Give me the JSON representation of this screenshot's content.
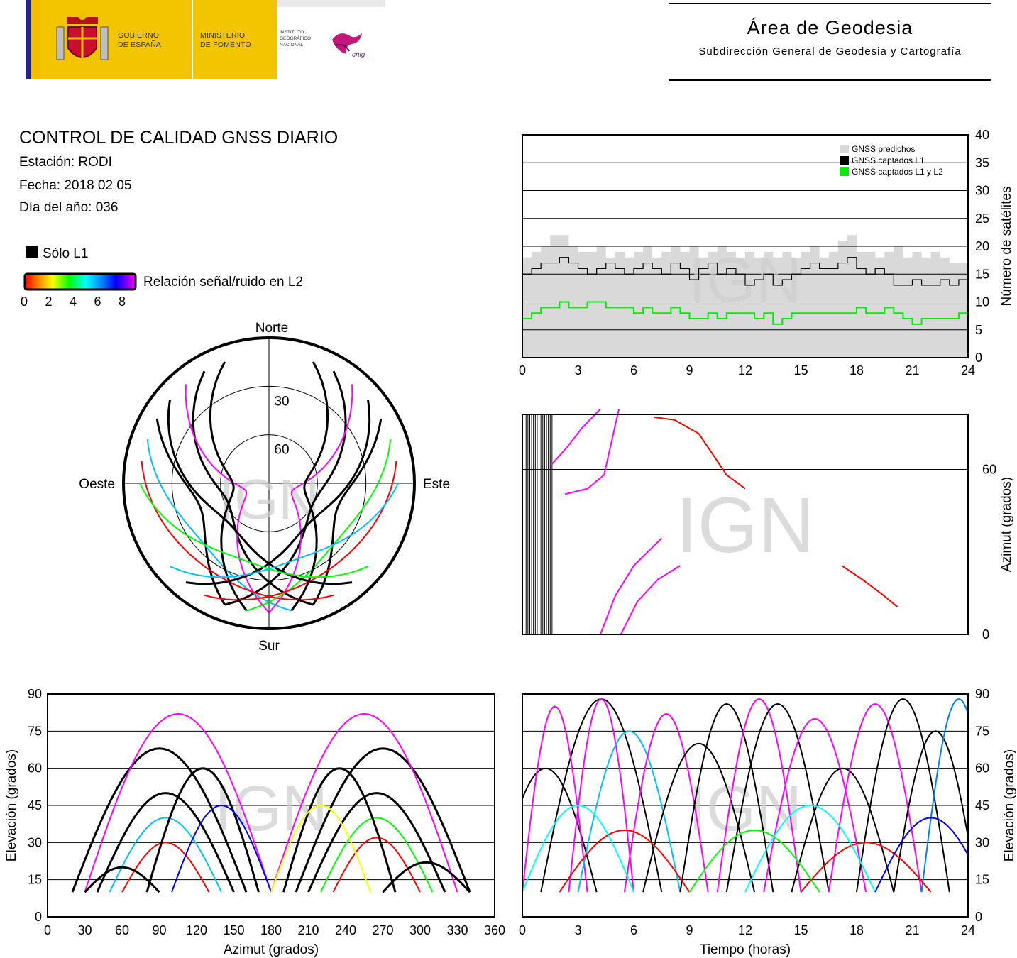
{
  "header": {
    "gov_line1": "GOBIERNO",
    "gov_line2": "DE ESPAÑA",
    "min_line1": "MINISTERIO",
    "min_line2": "DE FOMENTO",
    "inst_line1": "INSTITUTO",
    "inst_line2": "GEOGRÁFICO",
    "inst_line3": "NACIONAL",
    "cnig": "cnig",
    "area_title": "Área de Geodesia",
    "area_subtitle": "Subdirección General de Geodesia y Cartografía"
  },
  "info": {
    "title": "CONTROL DE CALIDAD GNSS DIARIO",
    "station": "Estación: RODI",
    "date": "Fecha: 2018 02 05",
    "doy": "Día del año: 036"
  },
  "legend": {
    "l1_only": "Sólo L1",
    "snr_label": "Relación señal/ruido en L2",
    "snr_ticks": [
      "0",
      "2",
      "4",
      "6",
      "8"
    ]
  },
  "watermark": "IGN",
  "colors": {
    "predicted": "#d9d9d9",
    "l1": "#000000",
    "l1l2": "#00ee00",
    "snr_scale": [
      "#ff0000",
      "#ff8000",
      "#ffff00",
      "#00ff00",
      "#00ffff",
      "#0080ff",
      "#0000ff",
      "#8000ff",
      "#ff00ff"
    ]
  },
  "chart_data": [
    {
      "id": "satellites",
      "type": "area",
      "xlabel": "",
      "ylabel": "Número de satélites",
      "xlim": [
        0,
        24
      ],
      "ylim": [
        0,
        40
      ],
      "xticks": [
        "0",
        "3",
        "6",
        "9",
        "12",
        "15",
        "18",
        "21",
        "24"
      ],
      "yticks": [
        "0",
        "5",
        "10",
        "15",
        "20",
        "25",
        "30",
        "35",
        "40"
      ],
      "grid": true,
      "legend_position": "top-right",
      "series": [
        {
          "name": "GNSS predichos",
          "x": [
            0,
            0.5,
            1,
            1.5,
            2,
            2.5,
            3,
            3.5,
            4,
            4.5,
            5,
            5.5,
            6,
            6.5,
            7,
            7.5,
            8,
            8.5,
            9,
            9.5,
            10,
            10.5,
            11,
            11.5,
            12,
            12.5,
            13,
            13.5,
            14,
            14.5,
            15,
            15.5,
            16,
            16.5,
            17,
            17.5,
            18,
            18.5,
            19,
            19.5,
            20,
            20.5,
            21,
            21.5,
            22,
            22.5,
            23,
            23.5,
            24
          ],
          "values": [
            18,
            19,
            20,
            22,
            22,
            20,
            19,
            19,
            20,
            18,
            19,
            18,
            19,
            20,
            18,
            19,
            20,
            19,
            20,
            18,
            19,
            20,
            19,
            18,
            19,
            18,
            19,
            18,
            19,
            18,
            19,
            20,
            18,
            19,
            21,
            22,
            19,
            19,
            18,
            19,
            20,
            18,
            19,
            18,
            19,
            18,
            17,
            17,
            17
          ]
        },
        {
          "name": "GNSS captados L1",
          "x": [
            0,
            0.5,
            1,
            1.5,
            2,
            2.5,
            3,
            3.5,
            4,
            4.5,
            5,
            5.5,
            6,
            6.5,
            7,
            7.5,
            8,
            8.5,
            9,
            9.5,
            10,
            10.5,
            11,
            11.5,
            12,
            12.5,
            13,
            13.5,
            14,
            14.5,
            15,
            15.5,
            16,
            16.5,
            17,
            17.5,
            18,
            18.5,
            19,
            19.5,
            20,
            20.5,
            21,
            21.5,
            22,
            22.5,
            23,
            23.5,
            24
          ],
          "values": [
            15,
            16,
            17,
            17,
            18,
            17,
            16,
            15,
            16,
            17,
            16,
            15,
            16,
            17,
            16,
            15,
            17,
            16,
            14,
            16,
            17,
            15,
            16,
            15,
            13,
            14,
            15,
            13,
            14,
            15,
            16,
            17,
            16,
            16,
            17,
            18,
            16,
            15,
            16,
            15,
            13,
            13,
            14,
            13,
            13,
            14,
            13,
            14,
            14
          ]
        },
        {
          "name": "GNSS captados L1 y L2",
          "x": [
            0,
            0.5,
            1,
            1.5,
            2,
            2.5,
            3,
            3.5,
            4,
            4.5,
            5,
            5.5,
            6,
            6.5,
            7,
            7.5,
            8,
            8.5,
            9,
            9.5,
            10,
            10.5,
            11,
            11.5,
            12,
            12.5,
            13,
            13.5,
            14,
            14.5,
            15,
            15.5,
            16,
            16.5,
            17,
            17.5,
            18,
            18.5,
            19,
            19.5,
            20,
            20.5,
            21,
            21.5,
            22,
            22.5,
            23,
            23.5,
            24
          ],
          "values": [
            7,
            8,
            9,
            9,
            10,
            9,
            9,
            10,
            10,
            9,
            9,
            9,
            8,
            9,
            8,
            8,
            9,
            8,
            7,
            7,
            8,
            7,
            8,
            8,
            8,
            7,
            8,
            6,
            7,
            8,
            8,
            8,
            8,
            8,
            8,
            8,
            9,
            8,
            8,
            9,
            8,
            7,
            6,
            7,
            7,
            7,
            7,
            8,
            8
          ]
        }
      ]
    },
    {
      "id": "skyplot",
      "type": "scatter",
      "title": "",
      "directions": {
        "north": "Norte",
        "south": "Sur",
        "west": "Oeste",
        "east": "Este"
      },
      "ring_labels": [
        "30",
        "60"
      ],
      "description_series": "polar tracks (azimuth, elevation) colored by SNR",
      "tracks": [
        {
          "az0": 330,
          "az1": 160,
          "emax": 62,
          "color": "#000000"
        },
        {
          "az0": 30,
          "az1": 200,
          "emax": 60,
          "color": "#000000"
        },
        {
          "az0": 320,
          "az1": 180,
          "emax": 75,
          "color": "#ff00ff"
        },
        {
          "az0": 40,
          "az1": 180,
          "emax": 75,
          "color": "#ff00ff"
        },
        {
          "az0": 300,
          "az1": 200,
          "emax": 45,
          "color": "#000000"
        },
        {
          "az0": 60,
          "az1": 160,
          "emax": 45,
          "color": "#000000"
        },
        {
          "az0": 290,
          "az1": 170,
          "emax": 35,
          "color": "#00c0ff"
        },
        {
          "az0": 70,
          "az1": 190,
          "emax": 35,
          "color": "#00ff00"
        },
        {
          "az0": 310,
          "az1": 140,
          "emax": 55,
          "color": "#000000"
        },
        {
          "az0": 50,
          "az1": 220,
          "emax": 55,
          "color": "#000000"
        },
        {
          "az0": 280,
          "az1": 150,
          "emax": 25,
          "color": "#ff0000"
        },
        {
          "az0": 80,
          "az1": 210,
          "emax": 25,
          "color": "#ff0000"
        },
        {
          "az0": 340,
          "az1": 190,
          "emax": 68,
          "color": "#000000"
        },
        {
          "az0": 20,
          "az1": 170,
          "emax": 68,
          "color": "#000000"
        },
        {
          "az0": 270,
          "az1": 130,
          "emax": 40,
          "color": "#00ff00"
        },
        {
          "az0": 90,
          "az1": 230,
          "emax": 40,
          "color": "#00c0ff"
        }
      ]
    },
    {
      "id": "azimuth_time",
      "type": "line",
      "xlabel": "",
      "ylabel": "Azimut (grados)",
      "ylim": [
        0,
        80
      ],
      "yticks": [
        "0",
        "60"
      ],
      "grid": true,
      "series": [
        {
          "color": "#ff00ff",
          "x": [
            1.6,
            2.4,
            3.2,
            4.2
          ],
          "values": [
            62,
            68,
            75,
            82
          ]
        },
        {
          "color": "#ff00ff",
          "x": [
            2.3,
            3.5,
            4.4,
            5.2
          ],
          "values": [
            51,
            53,
            58,
            82
          ]
        },
        {
          "color": "#ff0000",
          "x": [
            7.1,
            8.2,
            9.5,
            10.3,
            11.0,
            12.0
          ],
          "values": [
            79,
            78,
            73,
            65,
            58,
            53
          ]
        },
        {
          "color": "#ff00ff",
          "x": [
            4.2,
            5.0,
            6.0,
            7.5
          ],
          "values": [
            0,
            14,
            25,
            35
          ]
        },
        {
          "color": "#ff00ff",
          "x": [
            5.3,
            6.2,
            7.3,
            8.5
          ],
          "values": [
            0,
            12,
            20,
            25
          ]
        },
        {
          "color": "#ff0000",
          "x": [
            17.2,
            18.3,
            19.3,
            20.2
          ],
          "values": [
            25,
            20,
            15,
            10
          ]
        }
      ]
    },
    {
      "id": "elevation_azimuth",
      "type": "line",
      "xlabel": "Azimut (grados)",
      "ylabel": "Elevación (grados)",
      "xlim": [
        0,
        360
      ],
      "ylim": [
        0,
        90
      ],
      "xticks": [
        "0",
        "30",
        "60",
        "90",
        "120",
        "150",
        "180",
        "210",
        "240",
        "270",
        "300",
        "330",
        "360"
      ],
      "yticks": [
        "0",
        "15",
        "30",
        "45",
        "60",
        "75",
        "90"
      ],
      "grid": true,
      "arcs": [
        {
          "a0": 20,
          "a1": 160,
          "emax": 68,
          "color": "#000000"
        },
        {
          "a0": 200,
          "a1": 340,
          "emax": 68,
          "color": "#000000"
        },
        {
          "a0": 40,
          "a1": 150,
          "emax": 50,
          "color": "#000000"
        },
        {
          "a0": 210,
          "a1": 320,
          "emax": 50,
          "color": "#000000"
        },
        {
          "a0": 60,
          "a1": 130,
          "emax": 30,
          "color": "#ff0000"
        },
        {
          "a0": 230,
          "a1": 300,
          "emax": 32,
          "color": "#ff0000"
        },
        {
          "a0": 30,
          "a1": 180,
          "emax": 82,
          "color": "#ff00ff"
        },
        {
          "a0": 180,
          "a1": 330,
          "emax": 82,
          "color": "#ff00ff"
        },
        {
          "a0": 50,
          "a1": 140,
          "emax": 40,
          "color": "#00c0ff"
        },
        {
          "a0": 220,
          "a1": 310,
          "emax": 40,
          "color": "#00ff00"
        },
        {
          "a0": 80,
          "a1": 170,
          "emax": 60,
          "color": "#000000"
        },
        {
          "a0": 190,
          "a1": 280,
          "emax": 60,
          "color": "#000000"
        },
        {
          "a0": 100,
          "a1": 180,
          "emax": 45,
          "color": "#0000ff"
        },
        {
          "a0": 180,
          "a1": 260,
          "emax": 45,
          "color": "#ffff00"
        },
        {
          "a0": 30,
          "a1": 90,
          "emax": 20,
          "color": "#000000"
        },
        {
          "a0": 270,
          "a1": 340,
          "emax": 22,
          "color": "#000000"
        }
      ]
    },
    {
      "id": "elevation_time",
      "type": "line",
      "xlabel": "Tiempo (horas)",
      "ylabel": "Elevación (grados)",
      "xlim": [
        0,
        24
      ],
      "ylim": [
        0,
        90
      ],
      "xticks": [
        "0",
        "3",
        "6",
        "9",
        "12",
        "15",
        "18",
        "21",
        "24"
      ],
      "yticks": [
        "0",
        "15",
        "30",
        "45",
        "60",
        "75",
        "90"
      ],
      "grid": true,
      "arcs": [
        {
          "t0": -1.5,
          "t1": 4.0,
          "emax": 60,
          "color": "#000000"
        },
        {
          "t0": 1.0,
          "t1": 7.5,
          "emax": 88,
          "color": "#000000"
        },
        {
          "t0": 2.5,
          "t1": 6.0,
          "emax": 88,
          "color": "#ff00ff"
        },
        {
          "t0": 0.0,
          "t1": 3.5,
          "emax": 85,
          "color": "#ff00ff"
        },
        {
          "t0": 3.0,
          "t1": 8.5,
          "emax": 75,
          "color": "#00c0ff"
        },
        {
          "t0": 5.5,
          "t1": 10.0,
          "emax": 82,
          "color": "#ff00ff"
        },
        {
          "t0": 6.5,
          "t1": 12.5,
          "emax": 70,
          "color": "#000000"
        },
        {
          "t0": 8.5,
          "t1": 13.5,
          "emax": 86,
          "color": "#000000"
        },
        {
          "t0": 10.5,
          "t1": 15.0,
          "emax": 88,
          "color": "#ff00ff"
        },
        {
          "t0": 11.0,
          "t1": 16.5,
          "emax": 86,
          "color": "#000000"
        },
        {
          "t0": 13.0,
          "t1": 18.5,
          "emax": 80,
          "color": "#ff00ff"
        },
        {
          "t0": 14.5,
          "t1": 20.0,
          "emax": 60,
          "color": "#000000"
        },
        {
          "t0": 16.5,
          "t1": 21.5,
          "emax": 86,
          "color": "#ff00ff"
        },
        {
          "t0": 18.0,
          "t1": 23.0,
          "emax": 88,
          "color": "#000000"
        },
        {
          "t0": 20.0,
          "t1": 24.5,
          "emax": 75,
          "color": "#000000"
        },
        {
          "t0": 21.5,
          "t1": 25.5,
          "emax": 88,
          "color": "#0080ff"
        },
        {
          "t0": 2.0,
          "t1": 9.0,
          "emax": 35,
          "color": "#ff0000"
        },
        {
          "t0": 9.0,
          "t1": 16.0,
          "emax": 35,
          "color": "#00ff00"
        },
        {
          "t0": 15.0,
          "t1": 22.0,
          "emax": 30,
          "color": "#ff0000"
        },
        {
          "t0": 0.0,
          "t1": 6.0,
          "emax": 45,
          "color": "#00ffff"
        },
        {
          "t0": 12.0,
          "t1": 19.0,
          "emax": 45,
          "color": "#00ffff"
        },
        {
          "t0": 19.0,
          "t1": 25.0,
          "emax": 40,
          "color": "#0000ff"
        }
      ]
    }
  ]
}
